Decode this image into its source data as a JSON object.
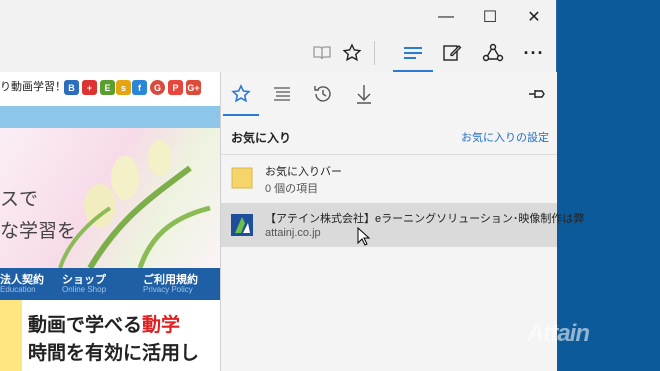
{
  "window": {
    "caption": {
      "minimize": "—",
      "maximize": "☐",
      "close": "✕"
    }
  },
  "toolbar": {
    "icons": [
      "reading-view-icon",
      "favorite-star-icon",
      "hub-icon",
      "web-note-icon",
      "share-icon",
      "more-icon"
    ],
    "more_label": "···"
  },
  "webpage": {
    "headline": "動画学習！",
    "headline_prefix": "り",
    "social_icons": [
      {
        "name": "hatena-bookmark-icon",
        "glyph": "B",
        "color": "#2c6ebd"
      },
      {
        "name": "add-icon",
        "glyph": "+",
        "color": "#d33"
      },
      {
        "name": "evernote-icon",
        "glyph": "E",
        "color": "#5a9e2f"
      },
      {
        "name": "share-icon",
        "glyph": "s",
        "color": "#e3a512"
      },
      {
        "name": "feedly-icon",
        "glyph": "f",
        "color": "#2a86d6"
      },
      {
        "name": "google-icon",
        "glyph": "G",
        "color": "#d54b3d"
      },
      {
        "name": "pocket-icon",
        "glyph": "P",
        "color": "#e8453c"
      },
      {
        "name": "google-plus-icon",
        "glyph": "G+",
        "color": "#dd4b39"
      }
    ],
    "banner_lines": [
      "スで",
      "な学習を"
    ],
    "nav": [
      {
        "label": "法人契約",
        "sub": "Education"
      },
      {
        "label": "ショップ",
        "sub": "Online Shop"
      },
      {
        "label": "ご利用規約",
        "sub": "Privacy Policy"
      }
    ],
    "promo_line1_a": "動画で学べる",
    "promo_line1_b": "動学",
    "promo_line2": "時間を有効に活用し"
  },
  "hub": {
    "tabs": [
      "favorites-tab",
      "reading-list-tab",
      "history-tab",
      "downloads-tab"
    ],
    "title": "お気に入り",
    "settings_link": "お気に入りの設定",
    "items": [
      {
        "name": "お気に入りバー",
        "sub": "0 個の項目"
      },
      {
        "name": "【アテイン株式会社】eラーニングソリューション･映像制作は弊",
        "sub": "attainj.co.jp"
      }
    ]
  },
  "watermark": "Attain",
  "colors": {
    "accent": "#2b7ad4",
    "desktop": "#0d5a9a",
    "nav": "#1f5fa5",
    "folder": "#f5d56a"
  }
}
